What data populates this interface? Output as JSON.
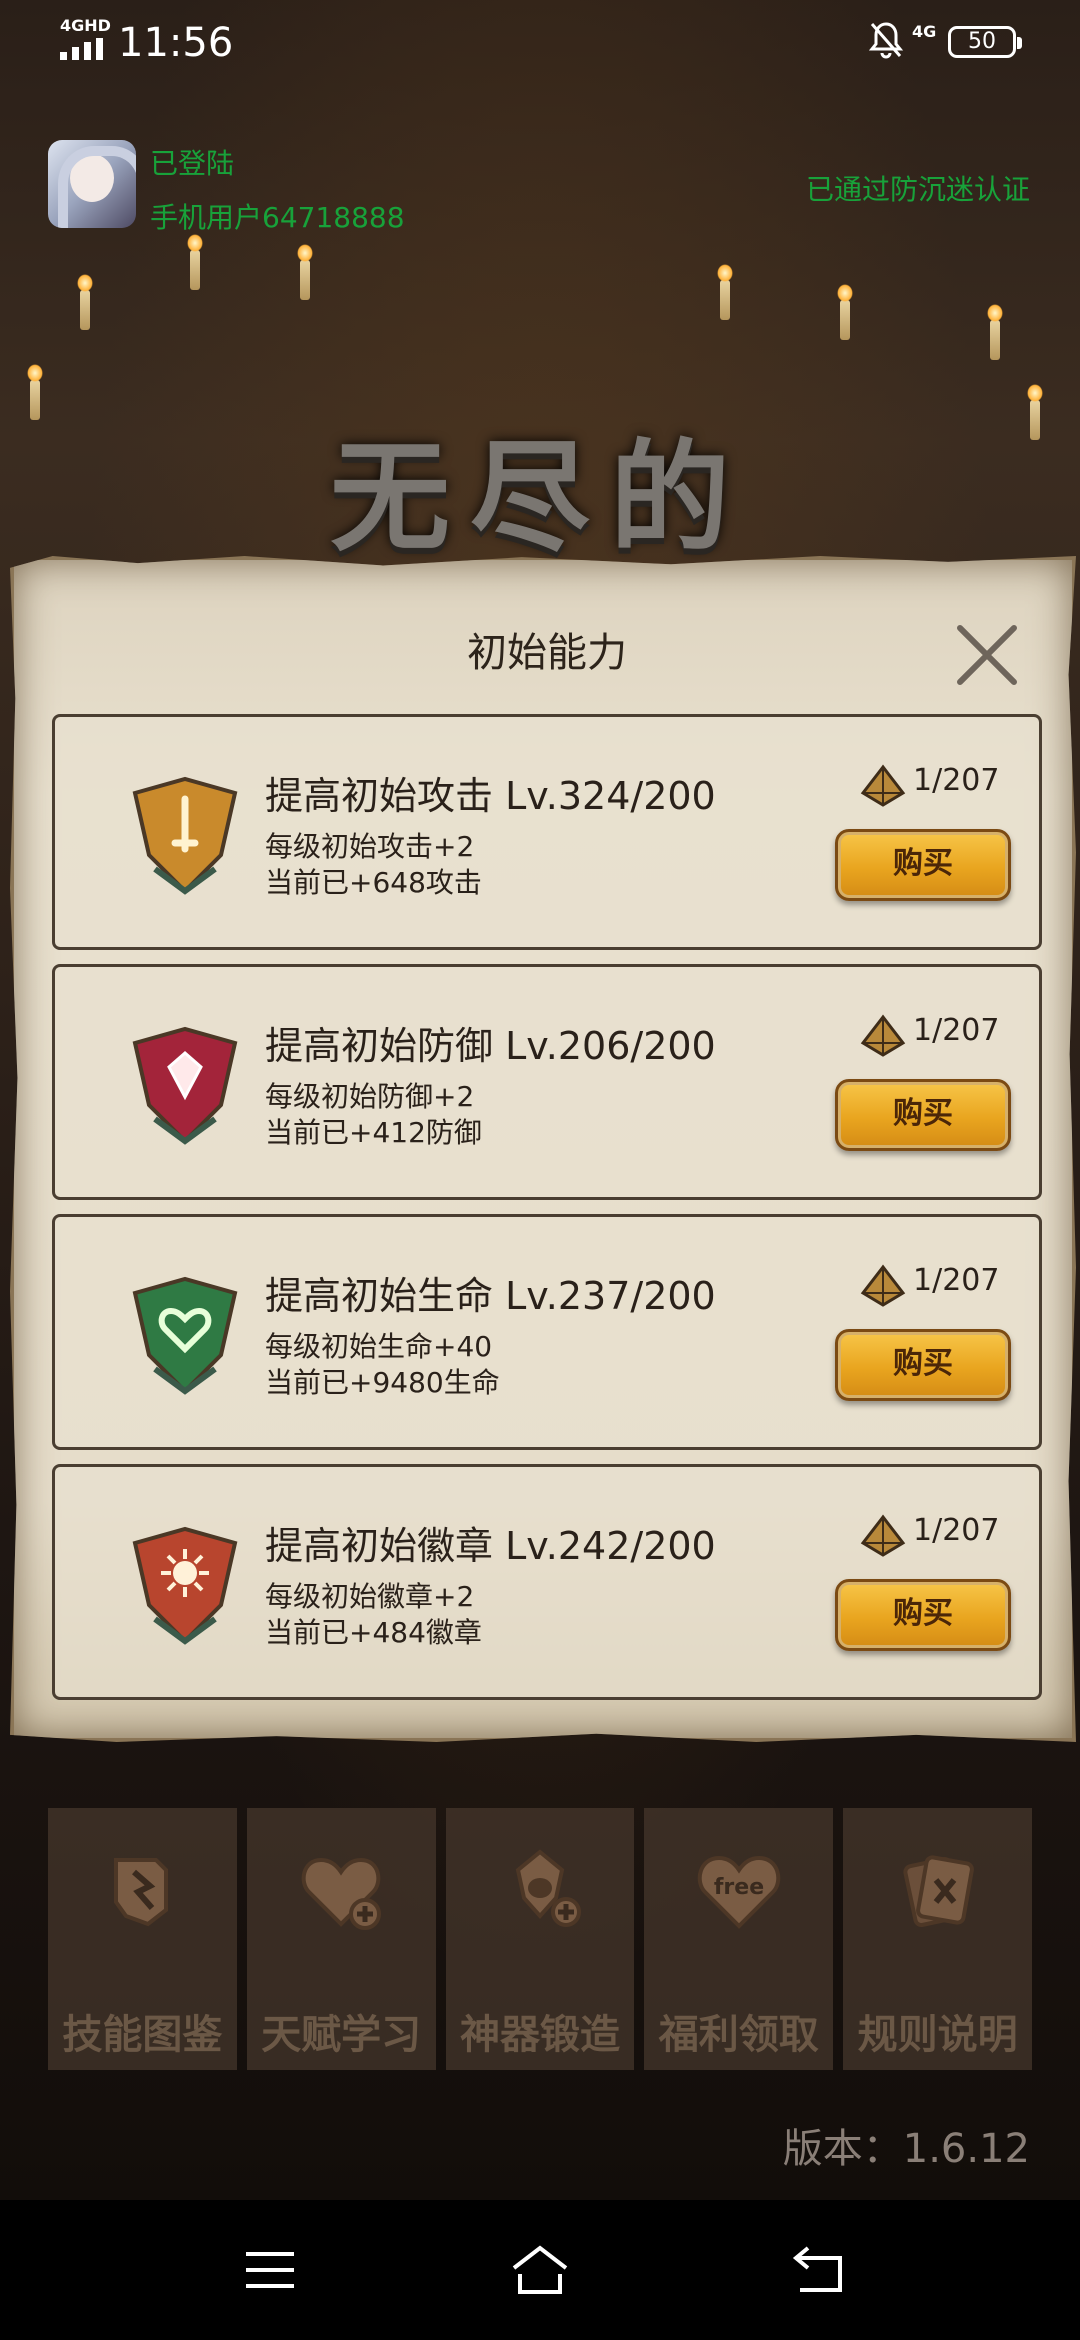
{
  "status_bar": {
    "network_left": "4GHD",
    "time": "11:56",
    "network_right": "4G",
    "battery": "50"
  },
  "login": {
    "status": "已登陆",
    "user": "手机用户64718888",
    "anti_addiction": "已通过防沉迷认证"
  },
  "background_title": "无尽的",
  "panel": {
    "title": "初始能力",
    "abilities": [
      {
        "title": "提高初始攻击 Lv.324/200",
        "per_level": "每级初始攻击+2",
        "current": "当前已+648攻击",
        "cost": "1/207",
        "buy": "购买",
        "gem_color": "#c98a2c",
        "icon": "sword-gem-icon"
      },
      {
        "title": "提高初始防御 Lv.206/200",
        "per_level": "每级初始防御+2",
        "current": "当前已+412防御",
        "cost": "1/207",
        "buy": "购买",
        "gem_color": "#a3243a",
        "icon": "shield-gem-icon"
      },
      {
        "title": "提高初始生命 Lv.237/200",
        "per_level": "每级初始生命+40",
        "current": "当前已+9480生命",
        "cost": "1/207",
        "buy": "购买",
        "gem_color": "#2f7a44",
        "icon": "heart-gem-icon"
      },
      {
        "title": "提高初始徽章 Lv.242/200",
        "per_level": "每级初始徽章+2",
        "current": "当前已+484徽章",
        "cost": "1/207",
        "buy": "购买",
        "gem_color": "#b8452e",
        "icon": "badge-gem-icon"
      }
    ]
  },
  "bottom_menu": [
    {
      "label": "技能图鉴",
      "icon": "skill-book-icon"
    },
    {
      "label": "天赋学习",
      "icon": "heart-plus-icon"
    },
    {
      "label": "神器锻造",
      "icon": "artifact-plus-icon"
    },
    {
      "label": "福利领取",
      "icon": "free-heart-icon"
    },
    {
      "label": "规则说明",
      "icon": "rules-cards-icon"
    }
  ],
  "version": "版本：1.6.12"
}
